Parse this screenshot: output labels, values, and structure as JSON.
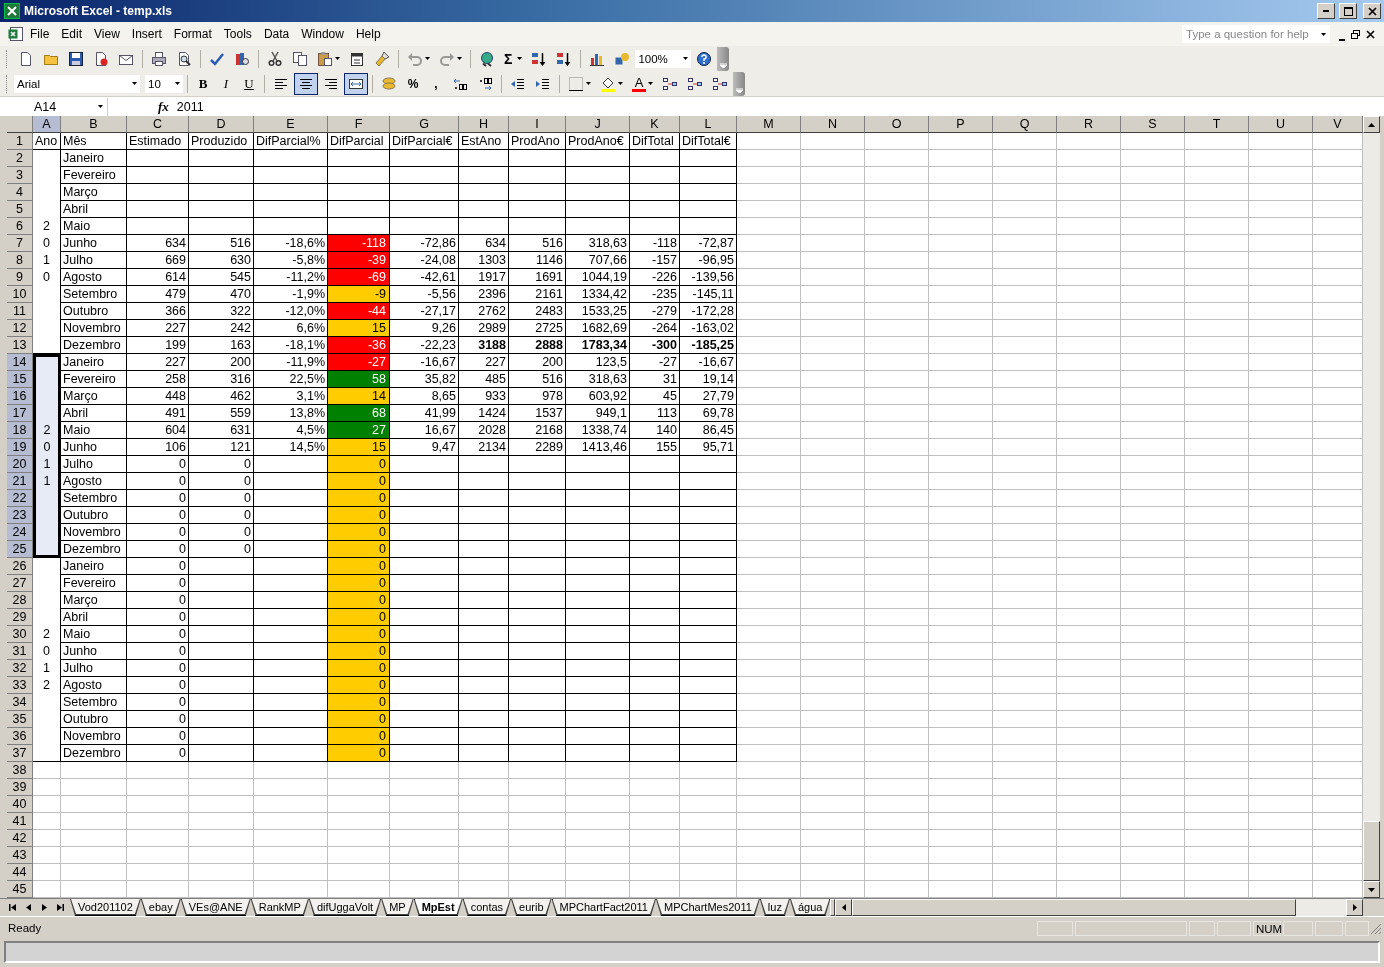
{
  "window": {
    "title": "Microsoft Excel - temp.xls"
  },
  "menu": {
    "items": [
      "File",
      "Edit",
      "View",
      "Insert",
      "Format",
      "Tools",
      "Data",
      "Window",
      "Help"
    ],
    "help_placeholder": "Type a question for help"
  },
  "standard_toolbar": {
    "sum_symbol": "Σ",
    "zoom": "100%"
  },
  "formatting_toolbar": {
    "font": "Arial",
    "size": "10",
    "style_buttons": [
      "B",
      "I",
      "U"
    ],
    "alignment_buttons": [
      {
        "selected": false
      },
      {
        "selected": true
      },
      {
        "selected": false
      }
    ],
    "merge_and_center": true,
    "number_buttons": [
      "%",
      ","
    ],
    "font_color_letter": "A"
  },
  "formula_bar": {
    "name_box": "A14",
    "function_label": "fx",
    "formula": "2011"
  },
  "sheet": {
    "columns": [
      {
        "label": "A",
        "selected": true
      },
      {
        "label": "B",
        "selected": false
      },
      {
        "label": "C",
        "selected": false
      },
      {
        "label": "D",
        "selected": false
      },
      {
        "label": "E",
        "selected": false
      },
      {
        "label": "F",
        "selected": false
      },
      {
        "label": "G",
        "selected": false
      },
      {
        "label": "H",
        "selected": false
      },
      {
        "label": "I",
        "selected": false
      },
      {
        "label": "J",
        "selected": false
      },
      {
        "label": "K",
        "selected": false
      },
      {
        "label": "L",
        "selected": false
      },
      {
        "label": "M",
        "selected": false
      },
      {
        "label": "N",
        "selected": false
      },
      {
        "label": "O",
        "selected": false
      },
      {
        "label": "P",
        "selected": false
      },
      {
        "label": "Q",
        "selected": false
      },
      {
        "label": "R",
        "selected": false
      },
      {
        "label": "S",
        "selected": false
      },
      {
        "label": "T",
        "selected": false
      },
      {
        "label": "U",
        "selected": false
      },
      {
        "label": "V",
        "selected": false
      }
    ],
    "header_row": {
      "header": "1",
      "selected": false,
      "cells": [
        "Ano",
        "Mês",
        "Estimado",
        "Produzido",
        "DifParcial%",
        "DifParcial",
        "DifParcial€",
        "EstAno",
        "ProdAno",
        "ProdAno€",
        "DifTotal",
        "DifTotal€"
      ]
    },
    "year_groups": [
      {
        "year": "2010",
        "selected": false,
        "rows": [
          {
            "kind": "month",
            "header": "2",
            "selected": false,
            "month": "Janeiro"
          },
          {
            "kind": "month",
            "header": "3",
            "selected": false,
            "month": "Fevereiro"
          },
          {
            "kind": "month",
            "header": "4",
            "selected": false,
            "month": "Março"
          },
          {
            "kind": "month",
            "header": "5",
            "selected": false,
            "month": "Abril"
          },
          {
            "kind": "month",
            "header": "6",
            "selected": false,
            "month": "Maio"
          },
          {
            "kind": "month",
            "header": "7",
            "selected": false,
            "month": "Junho",
            "cells": {
              "C": "634",
              "D": "516",
              "E": "-18,6%",
              "F": "-118",
              "G": "-72,86",
              "H": "634",
              "I": "516",
              "J": "318,63",
              "K": "-118",
              "L": "-72,87"
            },
            "color": "#ff0000"
          },
          {
            "kind": "month",
            "header": "8",
            "selected": false,
            "month": "Julho",
            "cells": {
              "C": "669",
              "D": "630",
              "E": "-5,8%",
              "F": "-39",
              "G": "-24,08",
              "H": "1303",
              "I": "1146",
              "J": "707,66",
              "K": "-157",
              "L": "-96,95"
            },
            "color": "#ff0000"
          },
          {
            "kind": "month",
            "header": "9",
            "selected": false,
            "month": "Agosto",
            "cells": {
              "C": "614",
              "D": "545",
              "E": "-11,2%",
              "F": "-69",
              "G": "-42,61",
              "H": "1917",
              "I": "1691",
              "J": "1044,19",
              "K": "-226",
              "L": "-139,56"
            },
            "color": "#ff0000"
          },
          {
            "kind": "month",
            "header": "10",
            "selected": false,
            "month": "Setembro",
            "cells": {
              "C": "479",
              "D": "470",
              "E": "-1,9%",
              "F": "-9",
              "G": "-5,56",
              "H": "2396",
              "I": "2161",
              "J": "1334,42",
              "K": "-235",
              "L": "-145,11"
            },
            "color": "#ffcc00"
          },
          {
            "kind": "month",
            "header": "11",
            "selected": false,
            "month": "Outubro",
            "cells": {
              "C": "366",
              "D": "322",
              "E": "-12,0%",
              "F": "-44",
              "G": "-27,17",
              "H": "2762",
              "I": "2483",
              "J": "1533,25",
              "K": "-279",
              "L": "-172,28"
            },
            "color": "#ff0000"
          },
          {
            "kind": "month",
            "header": "12",
            "selected": false,
            "month": "Novembro",
            "cells": {
              "C": "227",
              "D": "242",
              "E": "6,6%",
              "F": "15",
              "G": "9,26",
              "H": "2989",
              "I": "2725",
              "J": "1682,69",
              "K": "-264",
              "L": "-163,02"
            },
            "color": "#ffcc00"
          },
          {
            "kind": "total",
            "header": "13",
            "selected": false,
            "month": "Dezembro",
            "cells": {
              "C": "199",
              "D": "163",
              "E": "-18,1%",
              "F": "-36",
              "G": "-22,23",
              "H": "3188",
              "I": "2888",
              "J": "1783,34",
              "K": "-300",
              "L": "-185,25"
            },
            "color": "#ff0000"
          }
        ]
      },
      {
        "year": "2011",
        "selected": true,
        "rows": [
          {
            "kind": "month",
            "header": "14",
            "selected": true,
            "month": "Janeiro",
            "cells": {
              "C": "227",
              "D": "200",
              "E": "-11,9%",
              "F": "-27",
              "G": "-16,67",
              "H": "227",
              "I": "200",
              "J": "123,5",
              "K": "-27",
              "L": "-16,67"
            },
            "color": "#ff0000"
          },
          {
            "kind": "month",
            "header": "15",
            "selected": true,
            "month": "Fevereiro",
            "cells": {
              "C": "258",
              "D": "316",
              "E": "22,5%",
              "F": "58",
              "G": "35,82",
              "H": "485",
              "I": "516",
              "J": "318,63",
              "K": "31",
              "L": "19,14"
            },
            "color": "#008000"
          },
          {
            "kind": "month",
            "header": "16",
            "selected": true,
            "month": "Março",
            "cells": {
              "C": "448",
              "D": "462",
              "E": "3,1%",
              "F": "14",
              "G": "8,65",
              "H": "933",
              "I": "978",
              "J": "603,92",
              "K": "45",
              "L": "27,79"
            },
            "color": "#ffcc00"
          },
          {
            "kind": "month",
            "header": "17",
            "selected": true,
            "month": "Abril",
            "cells": {
              "C": "491",
              "D": "559",
              "E": "13,8%",
              "F": "68",
              "G": "41,99",
              "H": "1424",
              "I": "1537",
              "J": "949,1",
              "K": "113",
              "L": "69,78"
            },
            "color": "#008000"
          },
          {
            "kind": "month",
            "header": "18",
            "selected": true,
            "month": "Maio",
            "cells": {
              "C": "604",
              "D": "631",
              "E": "4,5%",
              "F": "27",
              "G": "16,67",
              "H": "2028",
              "I": "2168",
              "J": "1338,74",
              "K": "140",
              "L": "86,45"
            },
            "color": "#008000"
          },
          {
            "kind": "month",
            "header": "19",
            "selected": true,
            "month": "Junho",
            "cells": {
              "C": "106",
              "D": "121",
              "E": "14,5%",
              "F": "15",
              "G": "9,47",
              "H": "2134",
              "I": "2289",
              "J": "1413,46",
              "K": "155",
              "L": "95,71"
            },
            "color": "#ffcc00"
          },
          {
            "kind": "month",
            "header": "20",
            "selected": true,
            "month": "Julho",
            "cells": {
              "C": "0",
              "D": "0",
              "F": "0"
            },
            "color": "#ffcc00"
          },
          {
            "kind": "month",
            "header": "21",
            "selected": true,
            "month": "Agosto",
            "cells": {
              "C": "0",
              "D": "0",
              "F": "0"
            },
            "color": "#ffcc00"
          },
          {
            "kind": "month",
            "header": "22",
            "selected": true,
            "month": "Setembro",
            "cells": {
              "C": "0",
              "D": "0",
              "F": "0"
            },
            "color": "#ffcc00"
          },
          {
            "kind": "month",
            "header": "23",
            "selected": true,
            "month": "Outubro",
            "cells": {
              "C": "0",
              "D": "0",
              "F": "0"
            },
            "color": "#ffcc00"
          },
          {
            "kind": "month",
            "header": "24",
            "selected": true,
            "month": "Novembro",
            "cells": {
              "C": "0",
              "D": "0",
              "F": "0"
            },
            "color": "#ffcc00"
          },
          {
            "kind": "month",
            "header": "25",
            "selected": true,
            "month": "Dezembro",
            "cells": {
              "C": "0",
              "D": "0",
              "F": "0"
            },
            "color": "#ffcc00"
          }
        ]
      },
      {
        "year": "2012",
        "selected": false,
        "rows": [
          {
            "kind": "month",
            "header": "26",
            "selected": false,
            "month": "Janeiro",
            "cells": {
              "C": "0",
              "F": "0"
            },
            "color": "#ffcc00"
          },
          {
            "kind": "month",
            "header": "27",
            "selected": false,
            "month": "Fevereiro",
            "cells": {
              "C": "0",
              "F": "0"
            },
            "color": "#ffcc00"
          },
          {
            "kind": "month",
            "header": "28",
            "selected": false,
            "month": "Março",
            "cells": {
              "C": "0",
              "F": "0"
            },
            "color": "#ffcc00"
          },
          {
            "kind": "month",
            "header": "29",
            "selected": false,
            "month": "Abril",
            "cells": {
              "C": "0",
              "F": "0"
            },
            "color": "#ffcc00"
          },
          {
            "kind": "month",
            "header": "30",
            "selected": false,
            "month": "Maio",
            "cells": {
              "C": "0",
              "F": "0"
            },
            "color": "#ffcc00"
          },
          {
            "kind": "month",
            "header": "31",
            "selected": false,
            "month": "Junho",
            "cells": {
              "C": "0",
              "F": "0"
            },
            "color": "#ffcc00"
          },
          {
            "kind": "month",
            "header": "32",
            "selected": false,
            "month": "Julho",
            "cells": {
              "C": "0",
              "F": "0"
            },
            "color": "#ffcc00"
          },
          {
            "kind": "month",
            "header": "33",
            "selected": false,
            "month": "Agosto",
            "cells": {
              "C": "0",
              "F": "0"
            },
            "color": "#ffcc00"
          },
          {
            "kind": "month",
            "header": "34",
            "selected": false,
            "month": "Setembro",
            "cells": {
              "C": "0",
              "F": "0"
            },
            "color": "#ffcc00"
          },
          {
            "kind": "month",
            "header": "35",
            "selected": false,
            "month": "Outubro",
            "cells": {
              "C": "0",
              "F": "0"
            },
            "color": "#ffcc00"
          },
          {
            "kind": "month",
            "header": "36",
            "selected": false,
            "month": "Novembro",
            "cells": {
              "C": "0",
              "F": "0"
            },
            "color": "#ffcc00"
          },
          {
            "kind": "month",
            "header": "37",
            "selected": false,
            "month": "Dezembro",
            "cells": {
              "C": "0",
              "F": "0"
            },
            "color": "#ffcc00"
          }
        ]
      }
    ],
    "empty_rows": [
      {
        "header": "38",
        "selected": false
      },
      {
        "header": "39",
        "selected": false
      },
      {
        "header": "40",
        "selected": false
      },
      {
        "header": "41",
        "selected": false
      },
      {
        "header": "42",
        "selected": false
      },
      {
        "header": "43",
        "selected": false
      },
      {
        "header": "44",
        "selected": false
      },
      {
        "header": "45",
        "selected": false
      }
    ]
  },
  "sheet_tabs": [
    {
      "label": "Vod201102",
      "selected": false
    },
    {
      "label": "ebay",
      "selected": false
    },
    {
      "label": "VEs@ANE",
      "selected": false
    },
    {
      "label": "RankMP",
      "selected": false
    },
    {
      "label": "difUggaVolt",
      "selected": false
    },
    {
      "label": "MP",
      "selected": false
    },
    {
      "label": "MpEst",
      "selected": true
    },
    {
      "label": "contas",
      "selected": false
    },
    {
      "label": "eurib",
      "selected": false
    },
    {
      "label": "MPChartFact2011",
      "selected": false
    },
    {
      "label": "MPChartMes2011",
      "selected": false
    },
    {
      "label": "luz",
      "selected": false
    },
    {
      "label": "água",
      "selected": false
    }
  ],
  "status_bar": {
    "message": "Ready",
    "indicators": [
      "NUM"
    ]
  }
}
